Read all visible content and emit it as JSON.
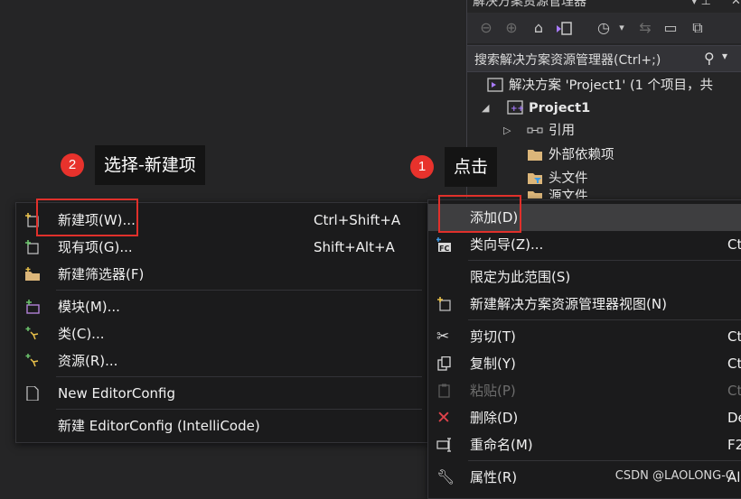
{
  "solution_explorer": {
    "title": "解决方案资源管理器",
    "search_placeholder": "搜索解决方案资源管理器(Ctrl+;)",
    "tree": [
      {
        "label": "解决方案 'Project1' (1 个项目，共",
        "icon": "solution-icon"
      },
      {
        "label": "Project1",
        "icon": "cpp-project-icon"
      },
      {
        "label": "引用",
        "icon": "references-icon"
      },
      {
        "label": "外部依赖项",
        "icon": "external-deps-icon"
      },
      {
        "label": "头文件",
        "icon": "filter-folder-icon"
      },
      {
        "label": "源文件",
        "icon": "filter-folder-icon"
      }
    ]
  },
  "submenu": {
    "items": [
      {
        "label": "新建项(W)...",
        "shortcut": "Ctrl+Shift+A"
      },
      {
        "label": "现有项(G)...",
        "shortcut": "Shift+Alt+A"
      },
      {
        "label": "新建筛选器(F)",
        "shortcut": ""
      },
      {
        "label": "模块(M)...",
        "shortcut": ""
      },
      {
        "label": "类(C)...",
        "shortcut": ""
      },
      {
        "label": "资源(R)...",
        "shortcut": ""
      },
      {
        "label": "New EditorConfig",
        "shortcut": ""
      },
      {
        "label": "新建 EditorConfig (IntelliCode)",
        "shortcut": ""
      }
    ]
  },
  "context_menu": {
    "items": [
      {
        "label": "添加(D)",
        "shortcut": ""
      },
      {
        "label": "类向导(Z)...",
        "shortcut": "Ct"
      },
      {
        "label": "限定为此范围(S)",
        "shortcut": ""
      },
      {
        "label": "新建解决方案资源管理器视图(N)",
        "shortcut": ""
      },
      {
        "label": "剪切(T)",
        "shortcut": "Ct"
      },
      {
        "label": "复制(Y)",
        "shortcut": "Ct"
      },
      {
        "label": "粘贴(P)",
        "shortcut": "Ct"
      },
      {
        "label": "删除(D)",
        "shortcut": "De"
      },
      {
        "label": "重命名(M)",
        "shortcut": "F2"
      },
      {
        "label": "属性(R)",
        "shortcut": "Al"
      }
    ]
  },
  "annotations": {
    "step1_number": "1",
    "step1_text": "点击",
    "step2_number": "2",
    "step2_text": "选择-新建项"
  },
  "colors": {
    "accent_red": "#e8322c",
    "menu_bg": "#1b1b1c",
    "highlight": "#3e3e40"
  },
  "watermark": "CSDN @LAOLONG-C"
}
